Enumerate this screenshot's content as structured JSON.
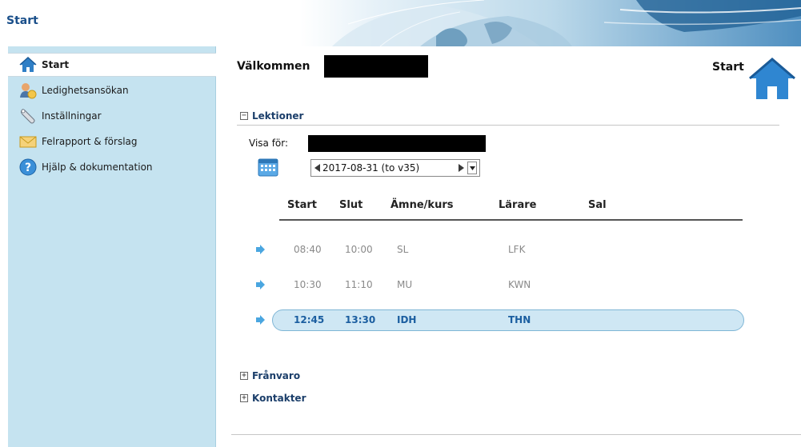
{
  "header": {
    "title": "Start"
  },
  "sidebar": {
    "items": [
      {
        "label": "Start",
        "icon": "home-icon",
        "active": true
      },
      {
        "label": "Ledighetsansökan",
        "icon": "user-leave-icon",
        "active": false
      },
      {
        "label": "Inställningar",
        "icon": "wrench-icon",
        "active": false
      },
      {
        "label": "Felrapport & förslag",
        "icon": "envelope-icon",
        "active": false
      },
      {
        "label": "Hjälp & dokumentation",
        "icon": "help-icon",
        "active": false
      }
    ]
  },
  "main": {
    "welcome": "Välkommen",
    "page_name": "Start",
    "sections": {
      "lektioner": "Lektioner",
      "franvaro": "Frånvaro",
      "kontakter": "Kontakter"
    },
    "visa_for_label": "Visa för:",
    "date_value": "2017-08-31 (to v35)",
    "table": {
      "headers": [
        "Start",
        "Slut",
        "Ämne/kurs",
        "Lärare",
        "Sal"
      ],
      "rows": [
        {
          "start": "08:40",
          "slut": "10:00",
          "amne": "SL",
          "larare": "LFK",
          "sal": ""
        },
        {
          "start": "10:30",
          "slut": "11:10",
          "amne": "MU",
          "larare": "KWN",
          "sal": ""
        },
        {
          "start": "12:45",
          "slut": "13:30",
          "amne": "IDH",
          "larare": "THN",
          "sal": ""
        }
      ]
    }
  },
  "colors": {
    "sidebar_bg": "#c5e3f0",
    "link_blue": "#1b3e6a",
    "current_row": "#cfe7f4",
    "current_text": "#1b5ea0"
  }
}
